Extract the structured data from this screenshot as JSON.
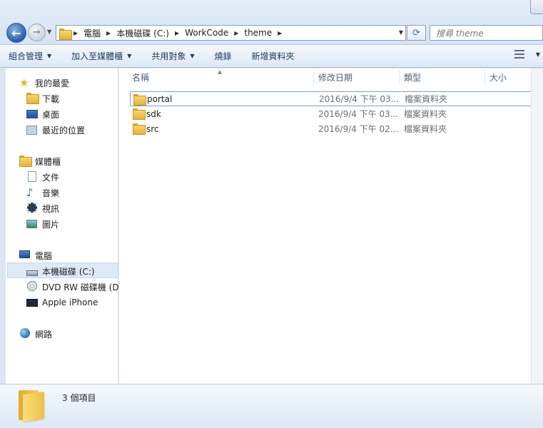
{
  "address": {
    "crumbs": [
      "電腦",
      "本機磁碟 (C:)",
      "WorkCode",
      "theme"
    ],
    "search_placeholder": "搜尋 theme"
  },
  "toolbar": {
    "organize": "組合管理",
    "include_in_library": "加入至媒體櫃",
    "share_with": "共用對象",
    "burn": "燒錄",
    "new_folder": "新增資料夾"
  },
  "nav": {
    "favorites": "我的最愛",
    "downloads": "下載",
    "desktop": "桌面",
    "recent": "最近的位置",
    "libraries": "媒體櫃",
    "documents": "文件",
    "music": "音樂",
    "videos": "視訊",
    "pictures": "圖片",
    "computer": "電腦",
    "local_disk": "本機磁碟 (C:)",
    "dvd": "DVD RW 磁碟機 (D:",
    "iphone": "Apple iPhone",
    "network": "網路"
  },
  "columns": {
    "name": "名稱",
    "modified": "修改日期",
    "type": "類型",
    "size": "大小"
  },
  "files": [
    {
      "name": "portal",
      "modified": "2016/9/4 下午 03...",
      "type": "檔案資料夾"
    },
    {
      "name": "sdk",
      "modified": "2016/9/4 下午 03...",
      "type": "檔案資料夾"
    },
    {
      "name": "src",
      "modified": "2016/9/4 下午 02...",
      "type": "檔案資料夾"
    }
  ],
  "details": {
    "item_count": "3 個項目"
  },
  "colors": {
    "accent": "#2c62b0",
    "folder": "#f3cf5d",
    "selection": "#dfe9f6"
  }
}
